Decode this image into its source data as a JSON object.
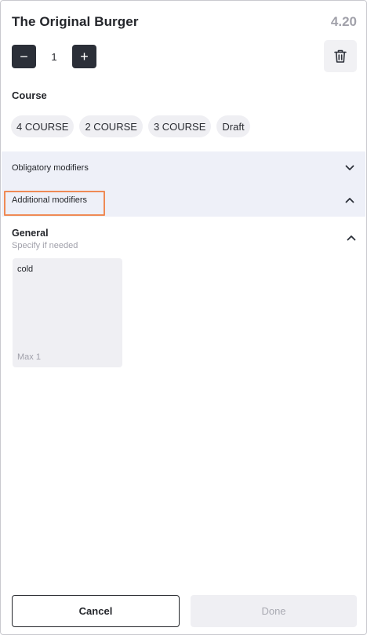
{
  "item": {
    "title": "The Original Burger",
    "price": "4.20"
  },
  "quantity": {
    "minus": "−",
    "value": "1",
    "plus": "+"
  },
  "course": {
    "label": "Course",
    "options": [
      "4 COURSE",
      "2 COURSE",
      "3 COURSE",
      "Draft"
    ]
  },
  "sections": {
    "obligatory": "Obligatory modifiers",
    "additional": "Additional modifiers"
  },
  "general": {
    "title": "General",
    "subtitle": "Specify if needed",
    "modifiers": [
      {
        "name": "cold",
        "limit": "Max 1"
      }
    ]
  },
  "footer": {
    "cancel": "Cancel",
    "done": "Done"
  },
  "colors": {
    "primary_dark": "#2b2f38",
    "section_bg": "#eef0f8",
    "chip_bg": "#efeff3",
    "highlight": "#ef8a55",
    "muted_text": "#a1a1aa"
  },
  "icons": {
    "trash": "trash-icon",
    "chevron_down": "chevron-down-icon",
    "chevron_up": "chevron-up-icon"
  }
}
